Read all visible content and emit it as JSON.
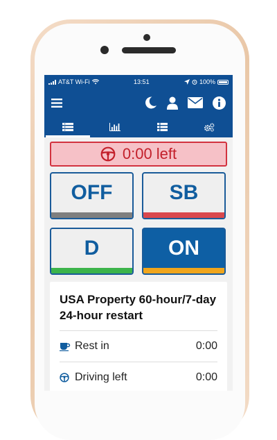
{
  "statusbar": {
    "carrier": "AT&T Wi-Fi",
    "time": "13:51",
    "battery": "100%"
  },
  "navbar": {
    "icons": [
      "menu-icon",
      "moon-icon",
      "user-icon",
      "envelope-icon",
      "info-icon"
    ]
  },
  "tabs": {
    "items": [
      {
        "icon": "list-view-icon",
        "active": true
      },
      {
        "icon": "bar-chart-icon",
        "active": false
      },
      {
        "icon": "table-list-icon",
        "active": false
      },
      {
        "icon": "gears-icon",
        "active": false
      }
    ]
  },
  "alert": {
    "icon": "steering-wheel-icon",
    "text": "0:00 left",
    "color": "#d2323f"
  },
  "status_buttons": {
    "off": {
      "label": "OFF",
      "bar_color": "#7f7f7f"
    },
    "sb": {
      "label": "SB",
      "bar_color": "#d9484d"
    },
    "d": {
      "label": "D",
      "bar_color": "#3cb44b"
    },
    "on": {
      "label": "ON",
      "bar_color": "#f0a51c",
      "active": true
    }
  },
  "rule_card": {
    "title": "USA Property 60-hour/7-day 24-hour restart",
    "rows": [
      {
        "icon": "coffee-cup-icon",
        "label": "Rest in",
        "value": "0:00"
      },
      {
        "icon": "steering-wheel-icon",
        "label": "Driving left",
        "value": "0:00"
      }
    ]
  },
  "colors": {
    "brand": "#0f4f94",
    "accent": "#105d9f"
  }
}
